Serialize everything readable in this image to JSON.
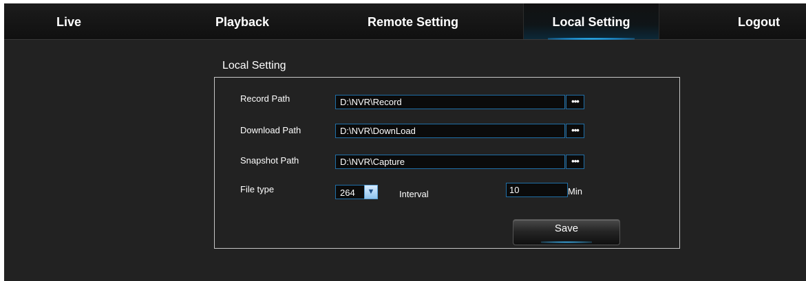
{
  "nav": {
    "tabs": [
      {
        "label": "Live"
      },
      {
        "label": "Playback"
      },
      {
        "label": "Remote Setting"
      },
      {
        "label": "Local Setting",
        "active": true
      },
      {
        "label": "Logout"
      }
    ]
  },
  "page": {
    "section_title": "Local Setting"
  },
  "form": {
    "record_path": {
      "label": "Record Path",
      "value": "D:\\NVR\\Record",
      "browse": "•••"
    },
    "download_path": {
      "label": "Download Path",
      "value": "D:\\NVR\\DownLoad",
      "browse": "•••"
    },
    "snapshot_path": {
      "label": "Snapshot Path",
      "value": "D:\\NVR\\Capture",
      "browse": "•••"
    },
    "file_type": {
      "label": "File type",
      "value": "264"
    },
    "interval": {
      "label": "Interval",
      "value": "10",
      "unit": "Min"
    },
    "save_label": "Save"
  },
  "colors": {
    "background": "#222222",
    "accent": "#1f6fa8",
    "active_glow": "#38c8ff"
  }
}
